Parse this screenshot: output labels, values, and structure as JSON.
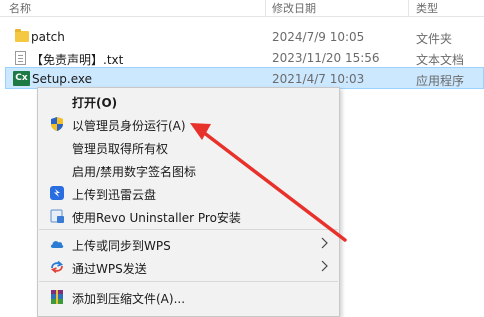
{
  "header": {
    "name": "名称",
    "modified": "修改日期",
    "type": "类型"
  },
  "files": [
    {
      "name": "patch",
      "modified": "2024/7/9 10:05",
      "type": "文件夹",
      "icon": "folder-icon"
    },
    {
      "name": "【免责声明】.txt",
      "modified": "2023/11/20 15:56",
      "type": "文本文档",
      "icon": "text-file-icon"
    },
    {
      "name": "Setup.exe",
      "modified": "2021/4/7 10:03",
      "type": "应用程序",
      "icon": "exe-icon",
      "icon_text": "Cx",
      "selected": true
    }
  ],
  "context_menu": {
    "items": [
      {
        "label": "打开(O)",
        "bold": true
      },
      {
        "label": "以管理员身份运行(A)",
        "icon": "uac-shield-icon"
      },
      {
        "label": "管理员取得所有权"
      },
      {
        "label": "启用/禁用数字签名图标"
      },
      {
        "label": "上传到迅雷云盘",
        "icon": "thunder-cloud-icon"
      },
      {
        "label": "使用Revo Uninstaller Pro安装",
        "icon": "revo-uninstaller-icon"
      },
      {
        "label": "上传或同步到WPS",
        "icon": "wps-cloud-icon",
        "submenu": true
      },
      {
        "label": "通过WPS发送",
        "icon": "wps-send-icon",
        "submenu": true
      },
      {
        "label": "添加到压缩文件(A)...",
        "icon": "winrar-icon"
      }
    ]
  },
  "colors": {
    "selection": "#cce8ff",
    "selection_border": "#99d1ff",
    "arrow": "#e8312a",
    "menu_bg": "#f2f2f2"
  }
}
